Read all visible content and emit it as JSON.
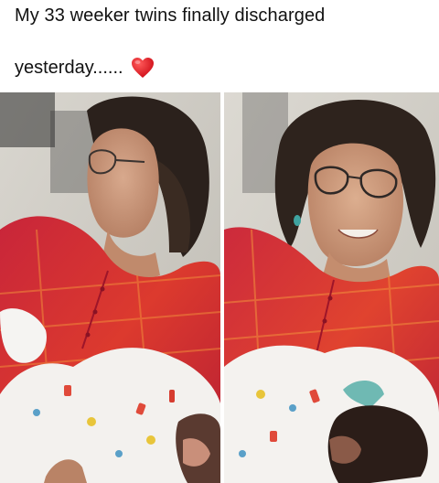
{
  "caption": {
    "line1": "My 33 weeker twins finally discharged",
    "line2": "yesterday......",
    "emoji": "red-heart"
  },
  "photos": [
    {
      "name": "photo-left"
    },
    {
      "name": "photo-right"
    }
  ]
}
